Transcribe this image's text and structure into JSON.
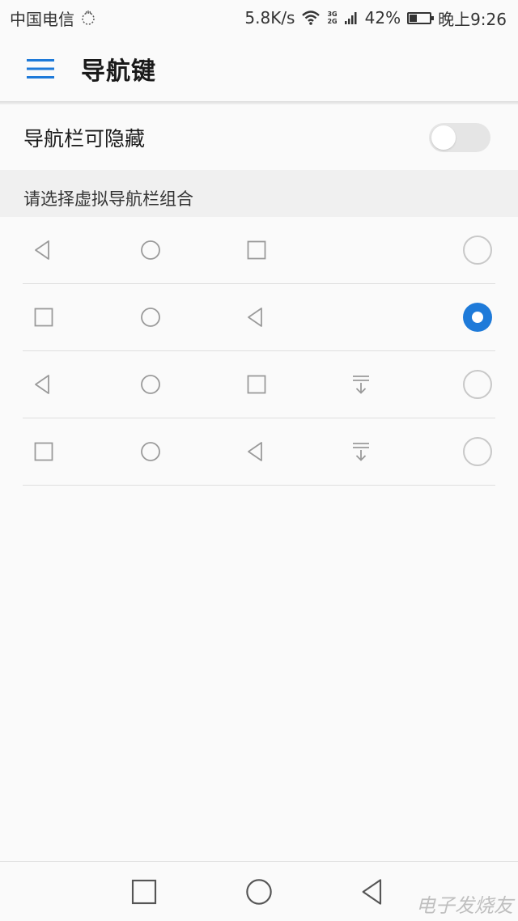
{
  "status_bar": {
    "carrier": "中国电信",
    "net_speed": "5.8K/s",
    "network_badge_top": "3G",
    "network_badge_bottom": "2G",
    "battery_percent": "42%",
    "battery_level": 0.42,
    "time": "晚上9:26"
  },
  "header": {
    "title": "导航键",
    "accent_color": "#1e7ad9"
  },
  "toggle": {
    "label": "导航栏可隐藏",
    "on": false
  },
  "section": {
    "title": "请选择虚拟导航栏组合"
  },
  "options": [
    {
      "keys": [
        "back",
        "home",
        "recent"
      ],
      "selected": false
    },
    {
      "keys": [
        "recent",
        "home",
        "back"
      ],
      "selected": true
    },
    {
      "keys": [
        "back",
        "home",
        "recent",
        "notification"
      ],
      "selected": false
    },
    {
      "keys": [
        "recent",
        "home",
        "back",
        "notification"
      ],
      "selected": false
    }
  ],
  "nav_bar": {
    "buttons": [
      "recent",
      "home",
      "back"
    ]
  },
  "watermark": "电子发烧友"
}
